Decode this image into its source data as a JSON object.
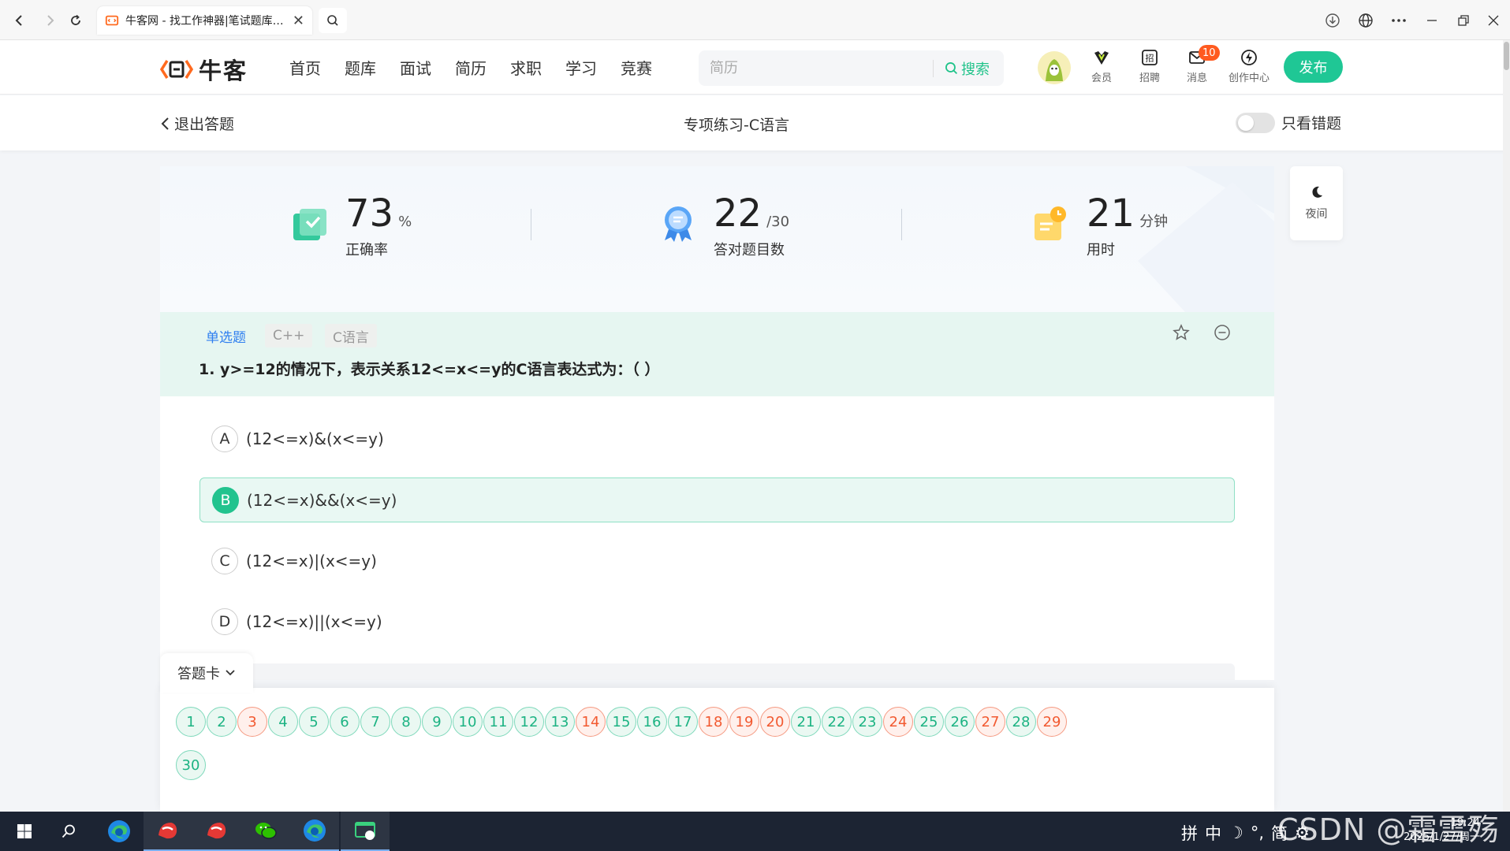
{
  "browser": {
    "tab_title": "牛客网 - 找工作神器|笔试题库|面试经验|实习招聘内推",
    "tab_close": "✕"
  },
  "header": {
    "logo_text": "牛客",
    "nav": [
      "首页",
      "题库",
      "面试",
      "简历",
      "求职",
      "学习",
      "竞赛"
    ],
    "search_placeholder": "简历",
    "search_button": "搜索",
    "icons": [
      {
        "label": "会员",
        "icon": "vip-icon"
      },
      {
        "label": "招聘",
        "icon": "recruit-icon"
      },
      {
        "label": "消息",
        "icon": "message-icon"
      },
      {
        "label": "创作中心",
        "icon": "creator-icon"
      }
    ],
    "message_badge": "10",
    "publish": "发布"
  },
  "subheader": {
    "exit": "退出答题",
    "title": "专项练习-C语言",
    "wrong_only": "只看错题"
  },
  "stats": {
    "accuracy": {
      "value": "73",
      "unit": "%",
      "label": "正确率"
    },
    "correct": {
      "value": "22",
      "unit": "/30",
      "label": "答对题目数"
    },
    "time": {
      "value": "21",
      "unit": "分钟",
      "label": "用时"
    }
  },
  "question": {
    "type": "单选题",
    "tags": [
      "C++",
      "C语言"
    ],
    "text": "1. y>=12的情况下，表示关系12<=x<=y的C语言表达式为：（ ）",
    "options": [
      {
        "letter": "A",
        "text": "(12<=x)&(x<=y)",
        "selected": false
      },
      {
        "letter": "B",
        "text": "(12<=x)&&(x<=y)",
        "selected": true
      },
      {
        "letter": "C",
        "text": "(12<=x)|(x<=y)",
        "selected": false
      },
      {
        "letter": "D",
        "text": "(12<=x)||(x<=y)",
        "selected": false
      }
    ]
  },
  "answer_card": {
    "label": "答题卡",
    "items": [
      {
        "n": "1",
        "wrong": false
      },
      {
        "n": "2",
        "wrong": false
      },
      {
        "n": "3",
        "wrong": true
      },
      {
        "n": "4",
        "wrong": false
      },
      {
        "n": "5",
        "wrong": false
      },
      {
        "n": "6",
        "wrong": false
      },
      {
        "n": "7",
        "wrong": false
      },
      {
        "n": "8",
        "wrong": false
      },
      {
        "n": "9",
        "wrong": false
      },
      {
        "n": "10",
        "wrong": false
      },
      {
        "n": "11",
        "wrong": false
      },
      {
        "n": "12",
        "wrong": false
      },
      {
        "n": "13",
        "wrong": false
      },
      {
        "n": "14",
        "wrong": true
      },
      {
        "n": "15",
        "wrong": false
      },
      {
        "n": "16",
        "wrong": false
      },
      {
        "n": "17",
        "wrong": false
      },
      {
        "n": "18",
        "wrong": true
      },
      {
        "n": "19",
        "wrong": true
      },
      {
        "n": "20",
        "wrong": true
      },
      {
        "n": "21",
        "wrong": false
      },
      {
        "n": "22",
        "wrong": false
      },
      {
        "n": "23",
        "wrong": false
      },
      {
        "n": "24",
        "wrong": true
      },
      {
        "n": "25",
        "wrong": false
      },
      {
        "n": "26",
        "wrong": false
      },
      {
        "n": "27",
        "wrong": true
      },
      {
        "n": "28",
        "wrong": false
      },
      {
        "n": "29",
        "wrong": true
      },
      {
        "n": "30",
        "wrong": false
      }
    ]
  },
  "night_mode": "夜间",
  "taskbar": {
    "tray": [
      "拼",
      "中",
      "☽",
      "°,",
      "简",
      "⚙"
    ],
    "time": "19:24",
    "date": "2025/1/27/周一"
  },
  "watermark": "CSDN @霜雪殇璃",
  "colors": {
    "accent": "#1fc795",
    "wrong": "#f25a31",
    "link_blue": "#2f7ff0"
  }
}
